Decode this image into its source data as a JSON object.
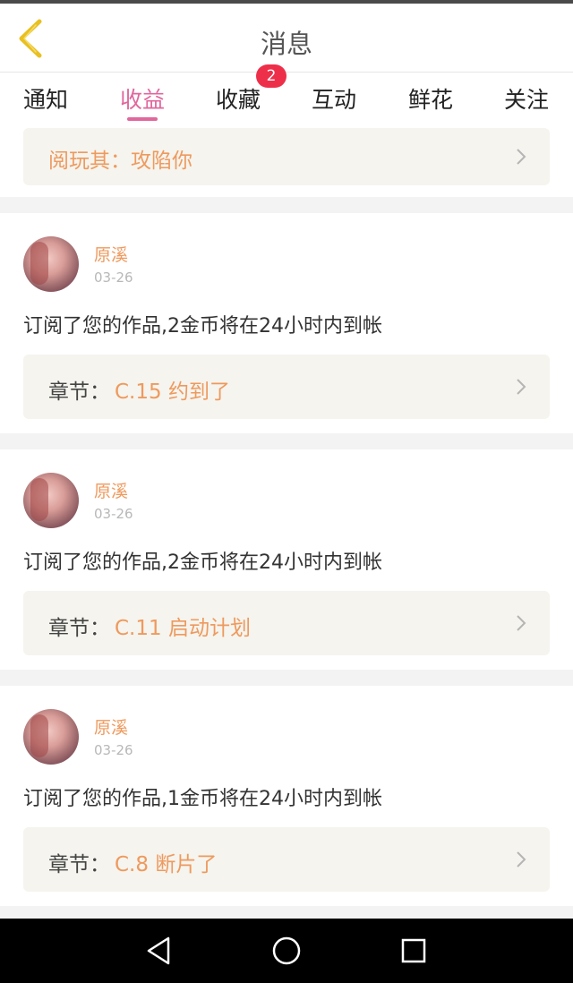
{
  "header": {
    "title": "消息"
  },
  "tabs": [
    {
      "label": "通知"
    },
    {
      "label": "收益",
      "active": true
    },
    {
      "label": "收藏",
      "badge": "2"
    },
    {
      "label": "互动"
    },
    {
      "label": "鲜花"
    },
    {
      "label": "关注"
    }
  ],
  "top_partial": {
    "text": "阅玩其：攻陷你"
  },
  "cards": [
    {
      "user": "原溪",
      "date": "03-26",
      "message": "订阅了您的作品,2金币将在24小时内到帐",
      "chapter_label": "章节：",
      "chapter": "C.15 约到了"
    },
    {
      "user": "原溪",
      "date": "03-26",
      "message": "订阅了您的作品,2金币将在24小时内到帐",
      "chapter_label": "章节：",
      "chapter": "C.11 启动计划"
    },
    {
      "user": "原溪",
      "date": "03-26",
      "message": "订阅了您的作品,1金币将在24小时内到帐",
      "chapter_label": "章节：",
      "chapter": "C.8 断片了"
    }
  ],
  "colors": {
    "accent": "#e0679d",
    "orange_text": "#ee9a5e",
    "badge": "#ee2f4a",
    "back_arrow": "#e8c020"
  },
  "icons": {
    "back": "chevron-left-icon",
    "chevron": "chevron-right-icon",
    "nav_back": "triangle-back-icon",
    "nav_home": "circle-home-icon",
    "nav_recent": "square-recent-icon"
  }
}
